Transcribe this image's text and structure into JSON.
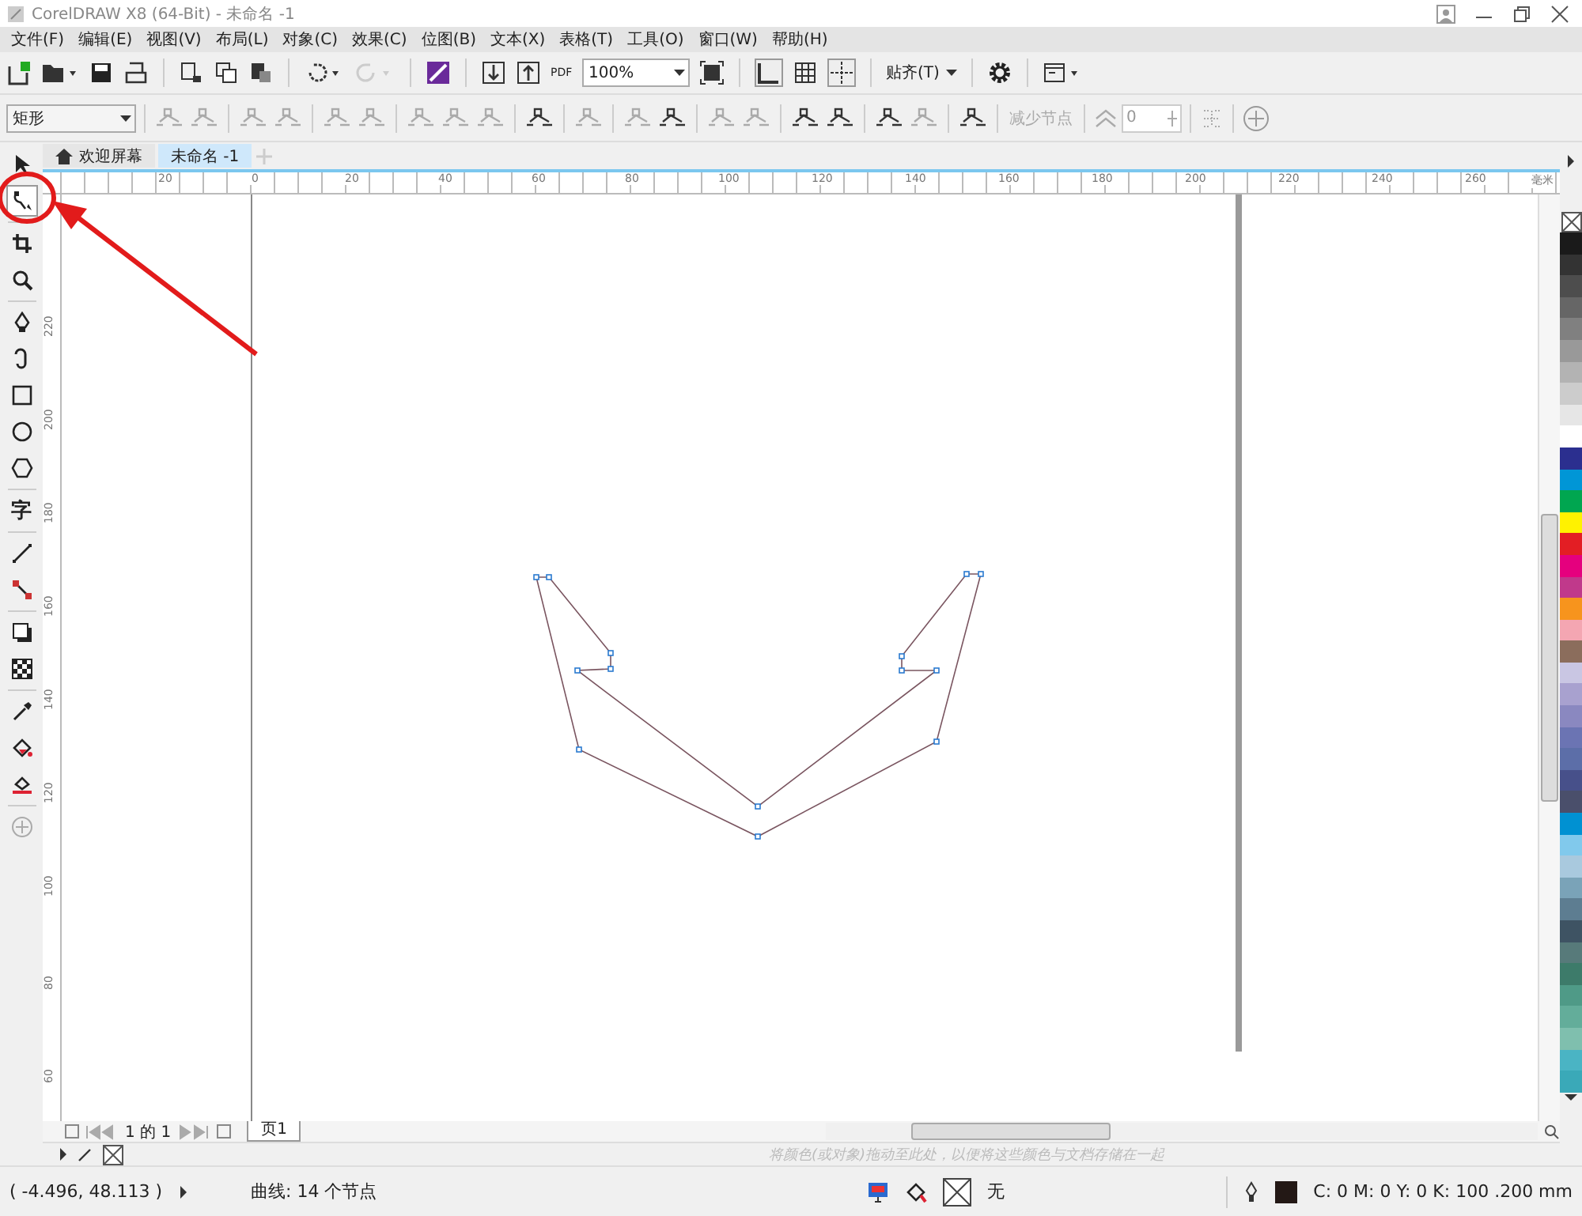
{
  "window": {
    "title": "CorelDRAW X8 (64-Bit) - 未命名 -1"
  },
  "menu": [
    "文件(F)",
    "编辑(E)",
    "视图(V)",
    "布局(L)",
    "对象(C)",
    "效果(C)",
    "位图(B)",
    "文本(X)",
    "表格(T)",
    "工具(O)",
    "窗口(W)",
    "帮助(H)"
  ],
  "standard_toolbar": {
    "pdf_label": "PDF",
    "zoom": "100%",
    "snap": "贴齐(T)"
  },
  "property_bar": {
    "shape_type": "矩形",
    "reduce_nodes": {
      "label": "减少节点",
      "disabled": true
    },
    "smoothness": "0"
  },
  "doc_tabs": [
    {
      "label": "欢迎屏幕",
      "kind": "home",
      "selected": false
    },
    {
      "label": "未命名 -1",
      "kind": "document",
      "selected": true
    }
  ],
  "toolbox": [
    {
      "kind": "pick",
      "selected": false
    },
    {
      "kind": "shape",
      "selected": true
    },
    {
      "kind": "crop",
      "selected": false
    },
    {
      "kind": "zoom",
      "selected": false
    },
    {
      "kind": "pen",
      "selected": false
    },
    {
      "kind": "artistic",
      "selected": false
    },
    {
      "kind": "rectangle",
      "selected": false
    },
    {
      "kind": "ellipse",
      "selected": false
    },
    {
      "kind": "polygon",
      "selected": false
    },
    {
      "kind": "text",
      "label": "字",
      "selected": false
    },
    {
      "kind": "dimension",
      "selected": false
    },
    {
      "kind": "connector",
      "selected": false
    },
    {
      "kind": "shadow",
      "selected": false
    },
    {
      "kind": "transparency",
      "selected": false
    },
    {
      "kind": "eyedropper",
      "selected": false
    },
    {
      "kind": "fill",
      "selected": false
    },
    {
      "kind": "smart-fill",
      "selected": false
    },
    {
      "kind": "add",
      "selected": false
    }
  ],
  "rulers": {
    "unit": "毫米",
    "horizontal": [
      "20",
      "0",
      "20",
      "40",
      "60",
      "80",
      "100",
      "120",
      "140",
      "160",
      "180",
      "200",
      "220",
      "240",
      "260"
    ],
    "vertical": [
      "220",
      "200",
      "180",
      "160",
      "140",
      "120",
      "100",
      "80",
      "60"
    ]
  },
  "page_nav": {
    "count": "1 的 1",
    "page_tab": "页1"
  },
  "palette_hint": "将颜色(或对象)拖动至此处，以便将这些颜色与文档存储在一起",
  "palette": [
    {
      "color": "#1a1a1a"
    },
    {
      "color": "#333333"
    },
    {
      "color": "#4d4d4d"
    },
    {
      "color": "#666666"
    },
    {
      "color": "#808080"
    },
    {
      "color": "#999999"
    },
    {
      "color": "#b3b3b3"
    },
    {
      "color": "#cccccc"
    },
    {
      "color": "#e6e6e6"
    },
    {
      "color": "#ffffff"
    },
    {
      "color": "#2b2f8f"
    },
    {
      "color": "#0096d6"
    },
    {
      "color": "#00a650"
    },
    {
      "color": "#fff200"
    },
    {
      "color": "#e31e24"
    },
    {
      "color": "#e5007e"
    },
    {
      "color": "#c0398b"
    },
    {
      "color": "#f7941d"
    },
    {
      "color": "#f4a6b2"
    },
    {
      "color": "#8b6d5c"
    },
    {
      "color": "#c9c6e3"
    },
    {
      "color": "#a8a1cf"
    },
    {
      "color": "#8a88c0"
    },
    {
      "color": "#6b74b3"
    },
    {
      "color": "#5c6ea8"
    },
    {
      "color": "#47508a"
    },
    {
      "color": "#4a4f6b"
    },
    {
      "color": "#0091d2"
    },
    {
      "color": "#81c9ec"
    },
    {
      "color": "#a9c9de"
    },
    {
      "color": "#7aa3b8"
    },
    {
      "color": "#5d7d91"
    },
    {
      "color": "#3e5363"
    },
    {
      "color": "#577a7a"
    },
    {
      "color": "#3d7b6a"
    },
    {
      "color": "#4f9a87"
    },
    {
      "color": "#63ad9a"
    },
    {
      "color": "#7fbfae"
    },
    {
      "color": "#4ab4c4"
    },
    {
      "color": "#3aa9b8"
    }
  ],
  "status": {
    "coords": "( -4.496, 48.113 )",
    "object": "曲线: 14 个节点",
    "fill": "无",
    "outline": {
      "color": "#231815",
      "label": "C: 0 M: 0 Y: 0 K: 100  .200 mm"
    }
  }
}
